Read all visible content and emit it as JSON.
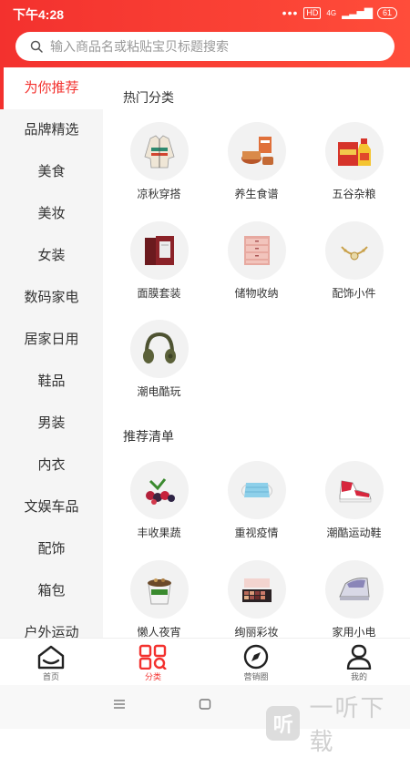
{
  "status": {
    "time": "下午4:28",
    "hd": "HD",
    "net": "4G",
    "battery": "61"
  },
  "search": {
    "placeholder": "输入商品名或粘贴宝贝标题搜索"
  },
  "sidebar": {
    "items": [
      {
        "label": "为你推荐"
      },
      {
        "label": "品牌精选"
      },
      {
        "label": "美食"
      },
      {
        "label": "美妆"
      },
      {
        "label": "女装"
      },
      {
        "label": "数码家电"
      },
      {
        "label": "居家日用"
      },
      {
        "label": "鞋品"
      },
      {
        "label": "男装"
      },
      {
        "label": "内衣"
      },
      {
        "label": "文娱车品"
      },
      {
        "label": "配饰"
      },
      {
        "label": "箱包"
      },
      {
        "label": "户外运动"
      }
    ]
  },
  "sections": {
    "hot": {
      "title": "热门分类",
      "items": [
        {
          "label": "凉秋穿搭",
          "icon": "jacket-icon"
        },
        {
          "label": "养生食谱",
          "icon": "tea-set-icon"
        },
        {
          "label": "五谷杂粮",
          "icon": "grain-oil-icon"
        },
        {
          "label": "面膜套装",
          "icon": "face-mask-box-icon"
        },
        {
          "label": "储物收纳",
          "icon": "storage-drawers-icon"
        },
        {
          "label": "配饰小件",
          "icon": "bracelet-icon"
        },
        {
          "label": "潮电酷玩",
          "icon": "headphones-icon"
        }
      ]
    },
    "rec": {
      "title": "推荐清单",
      "items": [
        {
          "label": "丰收果蔬",
          "icon": "berries-icon"
        },
        {
          "label": "重视疫情",
          "icon": "surgical-mask-icon"
        },
        {
          "label": "潮酷运动鞋",
          "icon": "sneaker-icon"
        },
        {
          "label": "懒人夜宵",
          "icon": "snack-cup-icon"
        },
        {
          "label": "绚丽彩妆",
          "icon": "eyeshadow-palette-icon"
        },
        {
          "label": "家用小电",
          "icon": "iron-icon"
        }
      ]
    }
  },
  "tabs": [
    {
      "label": "首页",
      "icon": "home-icon"
    },
    {
      "label": "分类",
      "icon": "category-icon"
    },
    {
      "label": "营销圈",
      "icon": "compass-icon"
    },
    {
      "label": "我的",
      "icon": "user-icon"
    }
  ],
  "watermark": {
    "logo": "听",
    "text": "一听下载"
  },
  "colors": {
    "accent": "#f3312e"
  }
}
